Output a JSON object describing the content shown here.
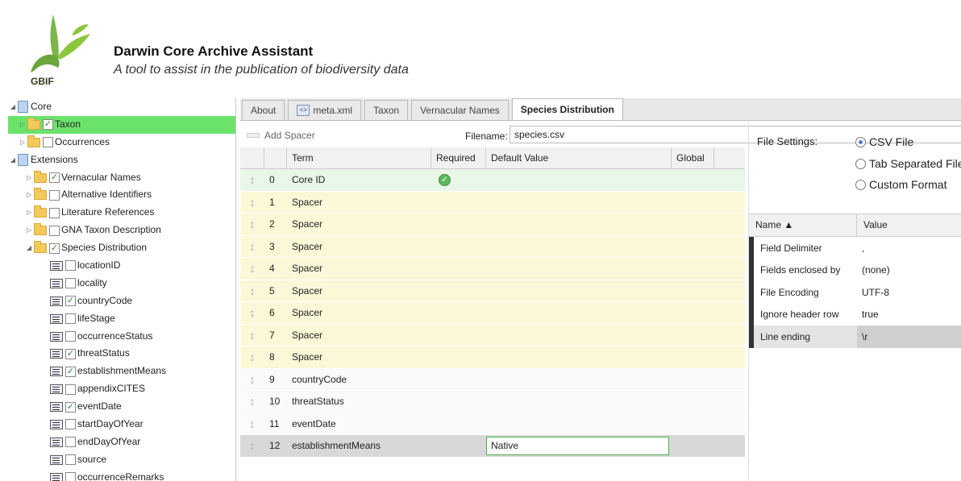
{
  "header": {
    "logo_text": "GBIF",
    "title": "Darwin Core Archive Assistant",
    "subtitle": "A tool to assist in the publication of biodiversity data"
  },
  "tree": {
    "core_label": "Core",
    "taxon_label": "Taxon",
    "occurrences_label": "Occurrences",
    "extensions_label": "Extensions",
    "extensions": [
      {
        "label": "Vernacular Names",
        "checked": true
      },
      {
        "label": "Alternative Identifiers",
        "checked": false
      },
      {
        "label": "Literature References",
        "checked": false
      },
      {
        "label": "GNA Taxon Description",
        "checked": false
      },
      {
        "label": "Species Distribution",
        "checked": true
      }
    ],
    "fields": [
      {
        "label": "locationID",
        "checked": false
      },
      {
        "label": "locality",
        "checked": false
      },
      {
        "label": "countryCode",
        "checked": true
      },
      {
        "label": "lifeStage",
        "checked": false
      },
      {
        "label": "occurrenceStatus",
        "checked": false
      },
      {
        "label": "threatStatus",
        "checked": true
      },
      {
        "label": "establishmentMeans",
        "checked": true
      },
      {
        "label": "appendixCITES",
        "checked": false
      },
      {
        "label": "eventDate",
        "checked": true
      },
      {
        "label": "startDayOfYear",
        "checked": false
      },
      {
        "label": "endDayOfYear",
        "checked": false
      },
      {
        "label": "source",
        "checked": false
      },
      {
        "label": "occurrenceRemarks",
        "checked": false
      }
    ]
  },
  "tabs": [
    {
      "label": "About"
    },
    {
      "label": "meta.xml"
    },
    {
      "label": "Taxon"
    },
    {
      "label": "Vernacular Names"
    },
    {
      "label": "Species Distribution"
    }
  ],
  "toolbar": {
    "add_spacer": "Add Spacer",
    "filename_label": "Filename:",
    "filename_value": "species.csv"
  },
  "grid": {
    "headers": {
      "term": "Term",
      "required": "Required",
      "default": "Default Value",
      "global": "Global"
    },
    "rows": [
      {
        "idx": "0",
        "term": "Core ID",
        "kind": "core",
        "required": true
      },
      {
        "idx": "1",
        "term": "Spacer",
        "kind": "spacer"
      },
      {
        "idx": "2",
        "term": "Spacer",
        "kind": "spacer"
      },
      {
        "idx": "3",
        "term": "Spacer",
        "kind": "spacer"
      },
      {
        "idx": "4",
        "term": "Spacer",
        "kind": "spacer"
      },
      {
        "idx": "5",
        "term": "Spacer",
        "kind": "spacer"
      },
      {
        "idx": "6",
        "term": "Spacer",
        "kind": "spacer"
      },
      {
        "idx": "7",
        "term": "Spacer",
        "kind": "spacer"
      },
      {
        "idx": "8",
        "term": "Spacer",
        "kind": "spacer"
      },
      {
        "idx": "9",
        "term": "countryCode",
        "kind": "normal"
      },
      {
        "idx": "10",
        "term": "threatStatus",
        "kind": "normal"
      },
      {
        "idx": "11",
        "term": "eventDate",
        "kind": "normal"
      },
      {
        "idx": "12",
        "term": "establishmentMeans",
        "kind": "editing",
        "default": "Native"
      }
    ]
  },
  "settings": {
    "label": "File Settings:",
    "options": [
      "CSV File",
      "Tab Separated File",
      "Custom Format"
    ],
    "selected": "CSV File",
    "props_header": {
      "name": "Name ▲",
      "value": "Value"
    },
    "props": [
      {
        "name": "Field Delimiter",
        "value": ","
      },
      {
        "name": "Fields enclosed by",
        "value": "(none)"
      },
      {
        "name": "File Encoding",
        "value": "UTF-8"
      },
      {
        "name": "Ignore header row",
        "value": "true"
      },
      {
        "name": "Line ending",
        "value": "\\r"
      }
    ]
  },
  "colors": {
    "selected_row": "#6be36b",
    "spacer_row": "#fbf8d8",
    "core_row": "#e8f7e8"
  }
}
